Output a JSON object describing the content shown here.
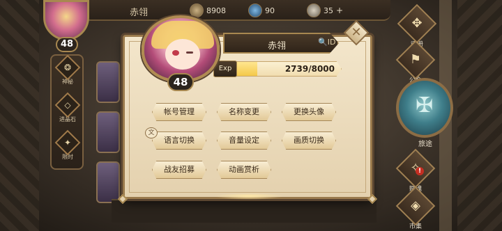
{
  "player": {
    "name": "赤翎",
    "level": "48",
    "exp_label": "Exp",
    "exp_text": "2739/8000",
    "exp_fraction": 0.342
  },
  "resources": {
    "gold": "8908",
    "gems": "90",
    "stamina": "35",
    "stamina_add": "+"
  },
  "left_menu": [
    {
      "label": "神秘",
      "icon": "mystery-icon"
    },
    {
      "label": "进晶石",
      "icon": "crystal-icon"
    },
    {
      "label": "限时",
      "icon": "gift-icon"
    }
  ],
  "right_menu": {
    "top": "魂册",
    "guild": "公会",
    "journey": "旅途",
    "soul": "赋魂",
    "market": "市集",
    "soul_badge": "!"
  },
  "dialog": {
    "id_icon_text": "ID",
    "buttons": [
      {
        "label": "帐号管理"
      },
      {
        "label": "名称变更"
      },
      {
        "label": "更换头像"
      },
      {
        "label": "语言切换"
      },
      {
        "label": "音量设定"
      },
      {
        "label": "画质切换"
      },
      {
        "label": "战友招募"
      },
      {
        "label": "动画赏析"
      }
    ]
  },
  "colors": {
    "exp_fill": "#f4c94a",
    "panel": "#f3e6cb",
    "gold_trim": "#a88850"
  }
}
